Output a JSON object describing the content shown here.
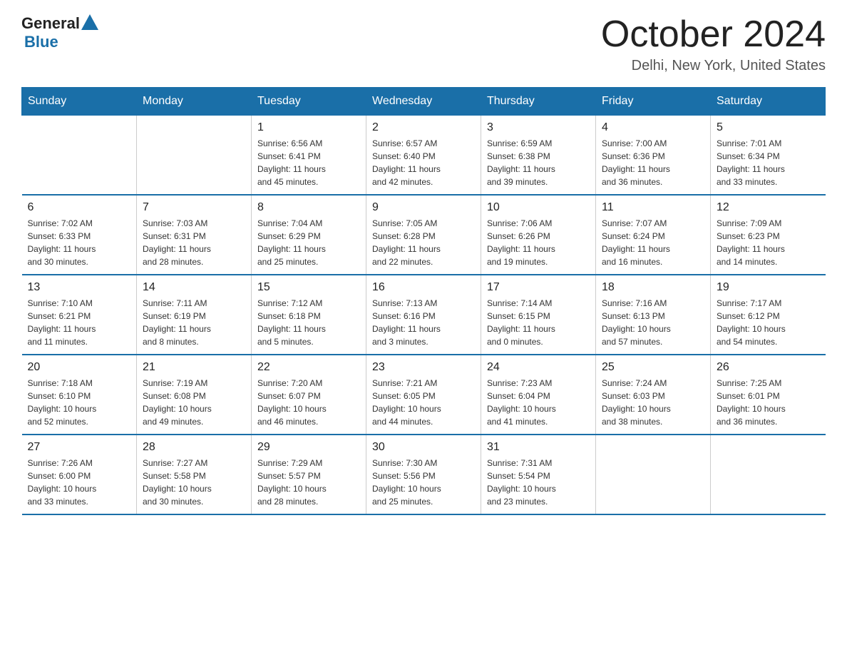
{
  "header": {
    "logo": {
      "text_general": "General",
      "text_blue": "Blue"
    },
    "title": "October 2024",
    "subtitle": "Delhi, New York, United States"
  },
  "weekdays": [
    "Sunday",
    "Monday",
    "Tuesday",
    "Wednesday",
    "Thursday",
    "Friday",
    "Saturday"
  ],
  "weeks": [
    [
      {
        "day": "",
        "info": ""
      },
      {
        "day": "",
        "info": ""
      },
      {
        "day": "1",
        "info": "Sunrise: 6:56 AM\nSunset: 6:41 PM\nDaylight: 11 hours\nand 45 minutes."
      },
      {
        "day": "2",
        "info": "Sunrise: 6:57 AM\nSunset: 6:40 PM\nDaylight: 11 hours\nand 42 minutes."
      },
      {
        "day": "3",
        "info": "Sunrise: 6:59 AM\nSunset: 6:38 PM\nDaylight: 11 hours\nand 39 minutes."
      },
      {
        "day": "4",
        "info": "Sunrise: 7:00 AM\nSunset: 6:36 PM\nDaylight: 11 hours\nand 36 minutes."
      },
      {
        "day": "5",
        "info": "Sunrise: 7:01 AM\nSunset: 6:34 PM\nDaylight: 11 hours\nand 33 minutes."
      }
    ],
    [
      {
        "day": "6",
        "info": "Sunrise: 7:02 AM\nSunset: 6:33 PM\nDaylight: 11 hours\nand 30 minutes."
      },
      {
        "day": "7",
        "info": "Sunrise: 7:03 AM\nSunset: 6:31 PM\nDaylight: 11 hours\nand 28 minutes."
      },
      {
        "day": "8",
        "info": "Sunrise: 7:04 AM\nSunset: 6:29 PM\nDaylight: 11 hours\nand 25 minutes."
      },
      {
        "day": "9",
        "info": "Sunrise: 7:05 AM\nSunset: 6:28 PM\nDaylight: 11 hours\nand 22 minutes."
      },
      {
        "day": "10",
        "info": "Sunrise: 7:06 AM\nSunset: 6:26 PM\nDaylight: 11 hours\nand 19 minutes."
      },
      {
        "day": "11",
        "info": "Sunrise: 7:07 AM\nSunset: 6:24 PM\nDaylight: 11 hours\nand 16 minutes."
      },
      {
        "day": "12",
        "info": "Sunrise: 7:09 AM\nSunset: 6:23 PM\nDaylight: 11 hours\nand 14 minutes."
      }
    ],
    [
      {
        "day": "13",
        "info": "Sunrise: 7:10 AM\nSunset: 6:21 PM\nDaylight: 11 hours\nand 11 minutes."
      },
      {
        "day": "14",
        "info": "Sunrise: 7:11 AM\nSunset: 6:19 PM\nDaylight: 11 hours\nand 8 minutes."
      },
      {
        "day": "15",
        "info": "Sunrise: 7:12 AM\nSunset: 6:18 PM\nDaylight: 11 hours\nand 5 minutes."
      },
      {
        "day": "16",
        "info": "Sunrise: 7:13 AM\nSunset: 6:16 PM\nDaylight: 11 hours\nand 3 minutes."
      },
      {
        "day": "17",
        "info": "Sunrise: 7:14 AM\nSunset: 6:15 PM\nDaylight: 11 hours\nand 0 minutes."
      },
      {
        "day": "18",
        "info": "Sunrise: 7:16 AM\nSunset: 6:13 PM\nDaylight: 10 hours\nand 57 minutes."
      },
      {
        "day": "19",
        "info": "Sunrise: 7:17 AM\nSunset: 6:12 PM\nDaylight: 10 hours\nand 54 minutes."
      }
    ],
    [
      {
        "day": "20",
        "info": "Sunrise: 7:18 AM\nSunset: 6:10 PM\nDaylight: 10 hours\nand 52 minutes."
      },
      {
        "day": "21",
        "info": "Sunrise: 7:19 AM\nSunset: 6:08 PM\nDaylight: 10 hours\nand 49 minutes."
      },
      {
        "day": "22",
        "info": "Sunrise: 7:20 AM\nSunset: 6:07 PM\nDaylight: 10 hours\nand 46 minutes."
      },
      {
        "day": "23",
        "info": "Sunrise: 7:21 AM\nSunset: 6:05 PM\nDaylight: 10 hours\nand 44 minutes."
      },
      {
        "day": "24",
        "info": "Sunrise: 7:23 AM\nSunset: 6:04 PM\nDaylight: 10 hours\nand 41 minutes."
      },
      {
        "day": "25",
        "info": "Sunrise: 7:24 AM\nSunset: 6:03 PM\nDaylight: 10 hours\nand 38 minutes."
      },
      {
        "day": "26",
        "info": "Sunrise: 7:25 AM\nSunset: 6:01 PM\nDaylight: 10 hours\nand 36 minutes."
      }
    ],
    [
      {
        "day": "27",
        "info": "Sunrise: 7:26 AM\nSunset: 6:00 PM\nDaylight: 10 hours\nand 33 minutes."
      },
      {
        "day": "28",
        "info": "Sunrise: 7:27 AM\nSunset: 5:58 PM\nDaylight: 10 hours\nand 30 minutes."
      },
      {
        "day": "29",
        "info": "Sunrise: 7:29 AM\nSunset: 5:57 PM\nDaylight: 10 hours\nand 28 minutes."
      },
      {
        "day": "30",
        "info": "Sunrise: 7:30 AM\nSunset: 5:56 PM\nDaylight: 10 hours\nand 25 minutes."
      },
      {
        "day": "31",
        "info": "Sunrise: 7:31 AM\nSunset: 5:54 PM\nDaylight: 10 hours\nand 23 minutes."
      },
      {
        "day": "",
        "info": ""
      },
      {
        "day": "",
        "info": ""
      }
    ]
  ]
}
